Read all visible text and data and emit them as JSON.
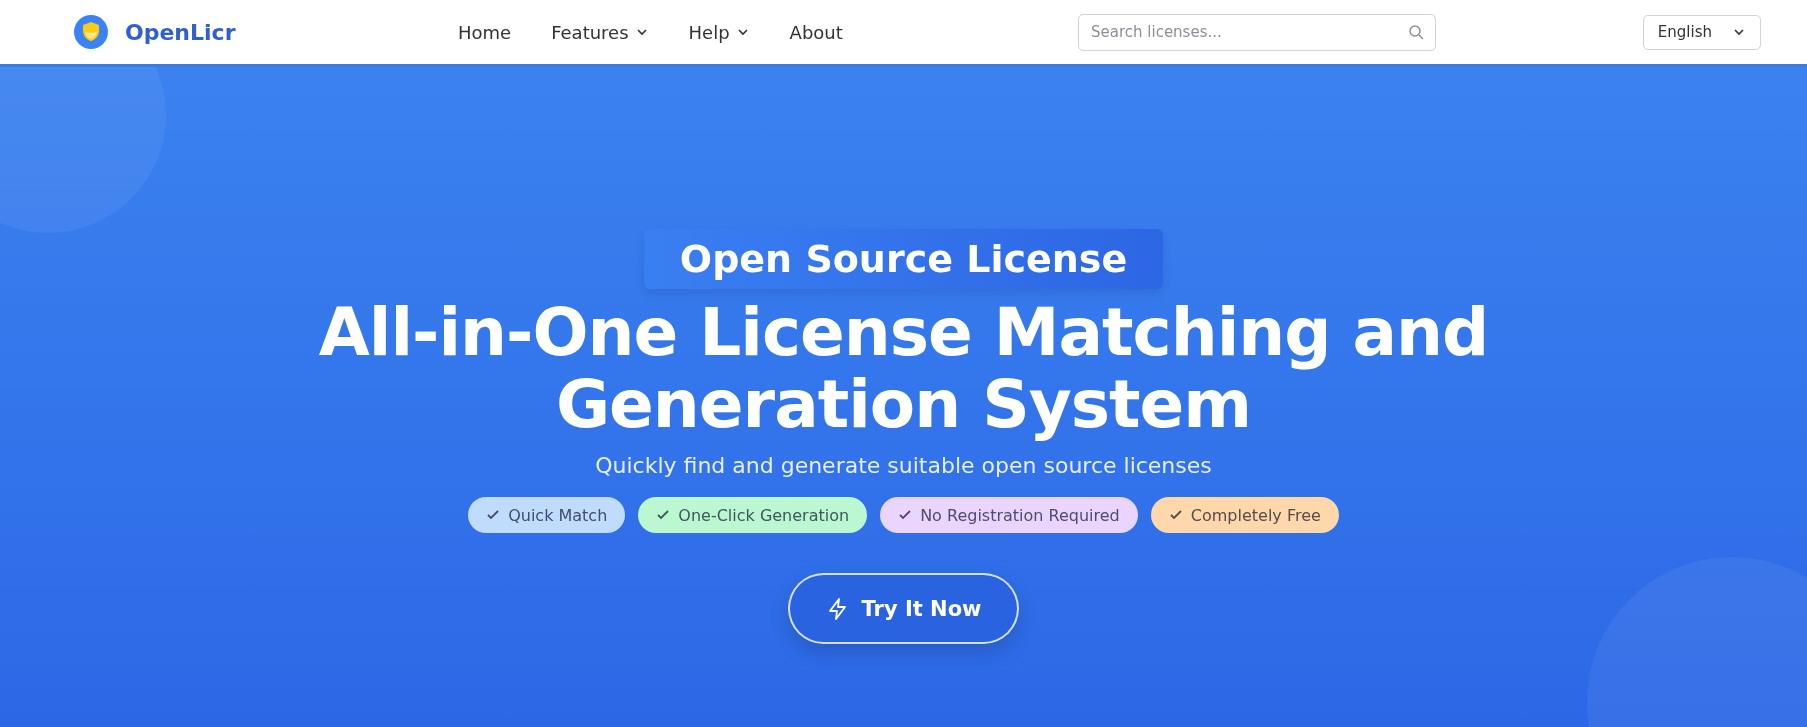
{
  "header": {
    "brand": "OpenLicr",
    "nav": [
      {
        "label": "Home",
        "dropdown": false
      },
      {
        "label": "Features",
        "dropdown": true
      },
      {
        "label": "Help",
        "dropdown": true
      },
      {
        "label": "About",
        "dropdown": false
      }
    ],
    "search": {
      "placeholder": "Search licenses..."
    },
    "language": "English"
  },
  "hero": {
    "badge": "Open Source License",
    "title": "All-in-One License Matching and Generation System",
    "subtitle": "Quickly find and generate suitable open source licenses",
    "tags": [
      {
        "label": "Quick Match",
        "color": "#bfdbfe"
      },
      {
        "label": "One-Click Generation",
        "color": "#bbf7d0"
      },
      {
        "label": "No Registration Required",
        "color": "#e9d5ff"
      },
      {
        "label": "Completely Free",
        "color": "#fed7aa"
      }
    ],
    "cta": "Try It Now"
  }
}
